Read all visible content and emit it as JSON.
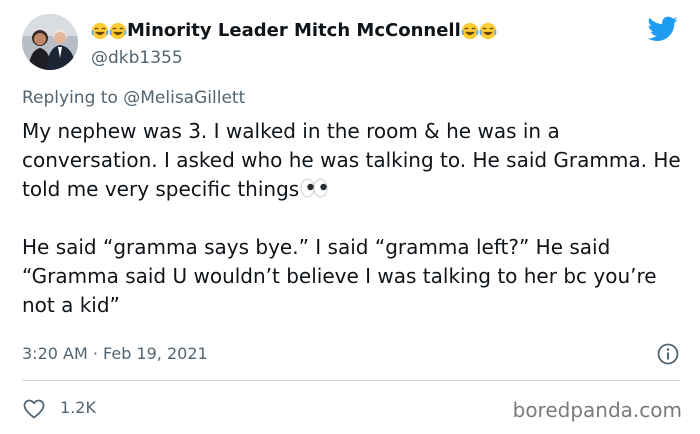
{
  "tweet": {
    "display_name_emoji_left": "😂😂",
    "display_name": "Minority Leader Mitch McConnell",
    "display_name_emoji_right": "😂😂",
    "handle": "@dkb1355",
    "reply_prefix": "Replying to",
    "reply_to": "@MelisaGillett",
    "paragraph_1": "My nephew was 3. I walked in the room & he was in a conversation. I asked who he was talking to. He said Gramma. He told me very specific things",
    "paragraph_1_emoji": "👀",
    "paragraph_2": "He said “gramma says bye.” I said “gramma left?” He said “Gramma said U wouldn’t believe I was talking to her bc you’re not a kid”",
    "timestamp": "3:20 AM · Feb 19, 2021",
    "like_count": "1.2K"
  },
  "icons": {
    "brand": "twitter-bird-icon",
    "info": "info-icon",
    "like": "heart-icon"
  },
  "colors": {
    "twitter_blue": "#1d9bf0",
    "muted_text": "#536471",
    "divider": "#cfd9de"
  },
  "watermark": "boredpanda.com"
}
